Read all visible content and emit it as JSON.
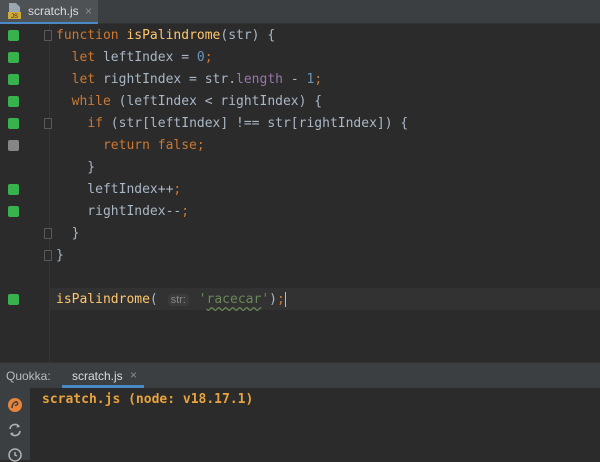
{
  "editor_tab": {
    "label": "scratch.js",
    "close": "×",
    "icon_badge": "JS"
  },
  "code_lines": [
    {
      "parts": [
        [
          "kw",
          "function "
        ],
        [
          "fn",
          "isPalindrome"
        ],
        [
          "p",
          "(str) {"
        ]
      ]
    },
    {
      "parts": [
        [
          "p",
          "  "
        ],
        [
          "kw",
          "let "
        ],
        [
          "p",
          "leftIndex = "
        ],
        [
          "num",
          "0"
        ],
        [
          "kw",
          ";"
        ]
      ]
    },
    {
      "parts": [
        [
          "p",
          "  "
        ],
        [
          "kw",
          "let "
        ],
        [
          "p",
          "rightIndex = str."
        ],
        [
          "prop",
          "length"
        ],
        [
          "p",
          " - "
        ],
        [
          "num",
          "1"
        ],
        [
          "kw",
          ";"
        ]
      ]
    },
    {
      "parts": [
        [
          "p",
          "  "
        ],
        [
          "kw",
          "while "
        ],
        [
          "p",
          "(leftIndex < rightIndex) {"
        ]
      ]
    },
    {
      "parts": [
        [
          "p",
          "    "
        ],
        [
          "kw",
          "if "
        ],
        [
          "p",
          "(str[leftIndex] !== str[rightIndex]) {"
        ]
      ]
    },
    {
      "parts": [
        [
          "p",
          "      "
        ],
        [
          "kw",
          "return false;"
        ]
      ]
    },
    {
      "parts": [
        [
          "p",
          "    }"
        ]
      ]
    },
    {
      "parts": [
        [
          "p",
          "    leftIndex++"
        ],
        [
          "kw",
          ";"
        ]
      ]
    },
    {
      "parts": [
        [
          "p",
          "    rightIndex--"
        ],
        [
          "kw",
          ";"
        ]
      ]
    },
    {
      "parts": [
        [
          "p",
          "  }"
        ]
      ]
    },
    {
      "parts": [
        [
          "p",
          "}"
        ]
      ]
    },
    {
      "parts": []
    },
    {
      "parts": [
        [
          "fn",
          "isPalindrome"
        ],
        [
          "p",
          "( "
        ],
        [
          "hint",
          "str:"
        ],
        [
          "strq",
          " '"
        ],
        [
          "str",
          "racecar"
        ],
        [
          "strq",
          "'"
        ],
        [
          "p",
          ")"
        ],
        [
          "kw",
          ";"
        ],
        [
          "caret",
          ""
        ]
      ]
    }
  ],
  "indicators": [
    "green",
    "green",
    "green",
    "green",
    "green",
    "gray",
    "",
    "green",
    "green",
    "",
    "",
    "",
    "green"
  ],
  "folds": [
    0,
    4,
    9,
    10
  ],
  "quokka_panel": {
    "title": "Quokka:",
    "tab_label": "scratch.js",
    "tab_close": "×",
    "output": "scratch.js (node: v18.17.1)"
  },
  "colors": {
    "accent": "#4a88c7",
    "indicator_green": "#37b24d",
    "indicator_gray": "#868686",
    "output_orange": "#e8a33c"
  }
}
